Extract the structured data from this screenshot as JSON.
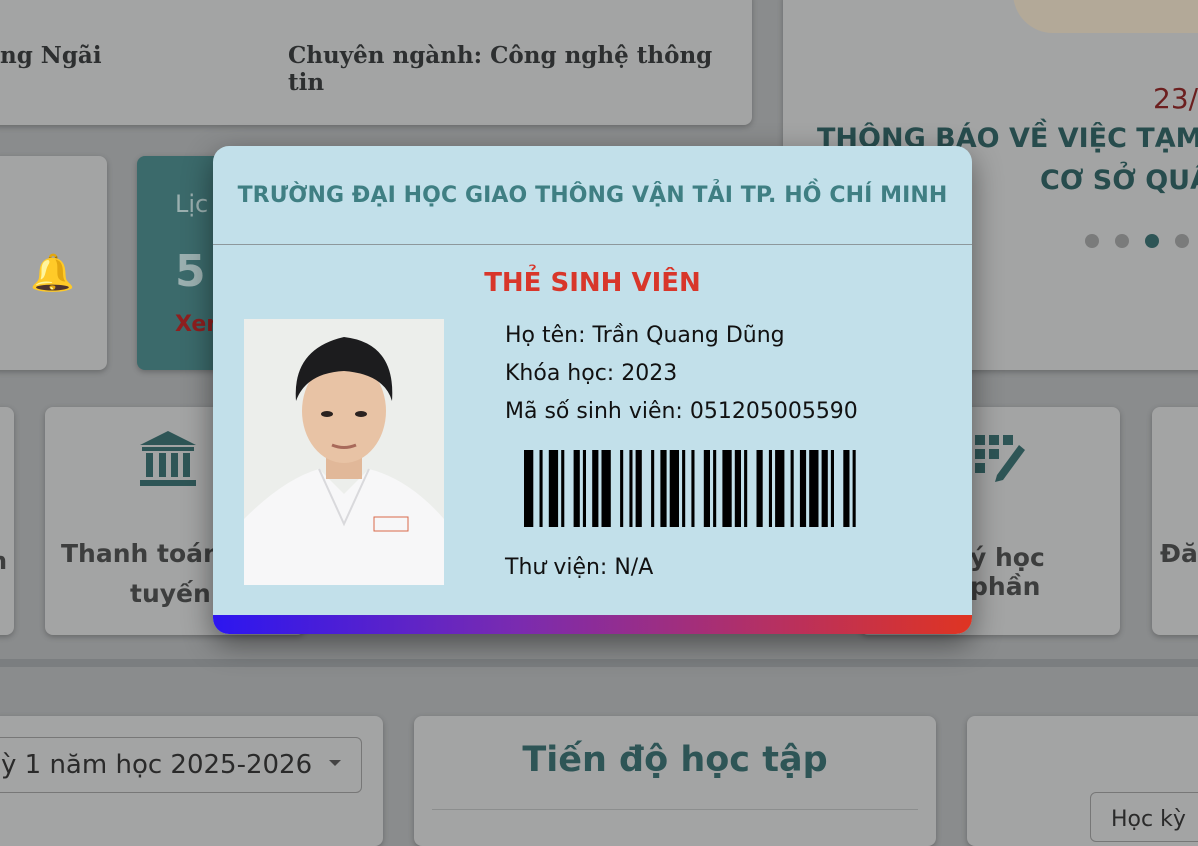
{
  "background": {
    "student_province": "ng Ngãi",
    "major": "Chuyên ngành: Công nghệ thông tin",
    "news_date": "23/",
    "news_title_line1": "THÔNG BÁO VỀ VIỆC TẠM N",
    "news_title_line2": "CƠ SỞ QUẬ",
    "schedule_label": "Lịc",
    "schedule_count": "5",
    "schedule_link": "Xem",
    "menu_left_partial": "n",
    "menu_payment_line1": "Thanh toán",
    "menu_payment_line2": "tuyến",
    "menu_register_line1": "ý học phần",
    "menu_right_partial": "Đăn",
    "semester_select_value": "ỳ 1 năm học 2025-2026",
    "progress_title": "Tiến độ học tập",
    "right_select_value": "Học kỳ"
  },
  "student_card": {
    "school_name": "TRƯỜNG ĐẠI HỌC GIAO THÔNG VẬN TẢI TP. HỒ CHÍ MINH",
    "card_title": "THẺ SINH VIÊN",
    "full_name": "Họ tên: Trần Quang Dũng",
    "course": "Khóa học: 2023",
    "student_id": "Mã số sinh viên: 051205005590",
    "library": "Thư viện: N/A",
    "accent_colors": {
      "title": "#d8362a",
      "school": "#3f7f83",
      "background": "#c2e0ea"
    }
  }
}
